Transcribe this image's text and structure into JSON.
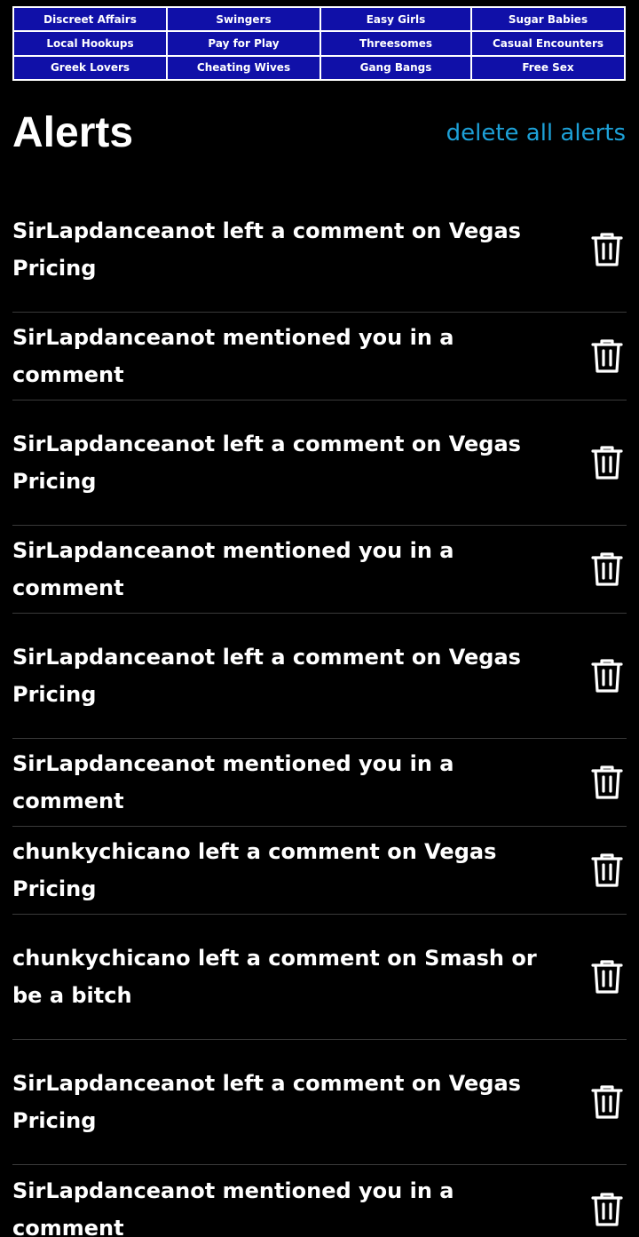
{
  "banner": {
    "links": [
      "Discreet Affairs",
      "Swingers",
      "Easy Girls",
      "Sugar Babies",
      "Local Hookups",
      "Pay for Play",
      "Threesomes",
      "Casual Encounters",
      "Greek Lovers",
      "Cheating Wives",
      "Gang Bangs",
      "Free Sex"
    ]
  },
  "header": {
    "title": "Alerts",
    "delete_all_label": "delete all alerts"
  },
  "alerts": [
    "SirLapdanceanot left a comment on Vegas Pricing",
    "SirLapdanceanot mentioned you in a comment",
    "SirLapdanceanot left a comment on Vegas Pricing",
    "SirLapdanceanot mentioned you in a comment",
    "SirLapdanceanot left a comment on Vegas Pricing",
    "SirLapdanceanot mentioned you in a comment",
    "chunkychicano left a comment on Vegas Pricing",
    "chunkychicano left a comment on Smash or be a bitch",
    "SirLapdanceanot left a comment on Vegas Pricing",
    "SirLapdanceanot mentioned you in a comment"
  ],
  "icons": {
    "delete": "trash-icon"
  },
  "colors": {
    "background": "#000000",
    "banner_cell": "#1010a8",
    "link_accent": "#1da1d8",
    "text": "#ffffff"
  }
}
